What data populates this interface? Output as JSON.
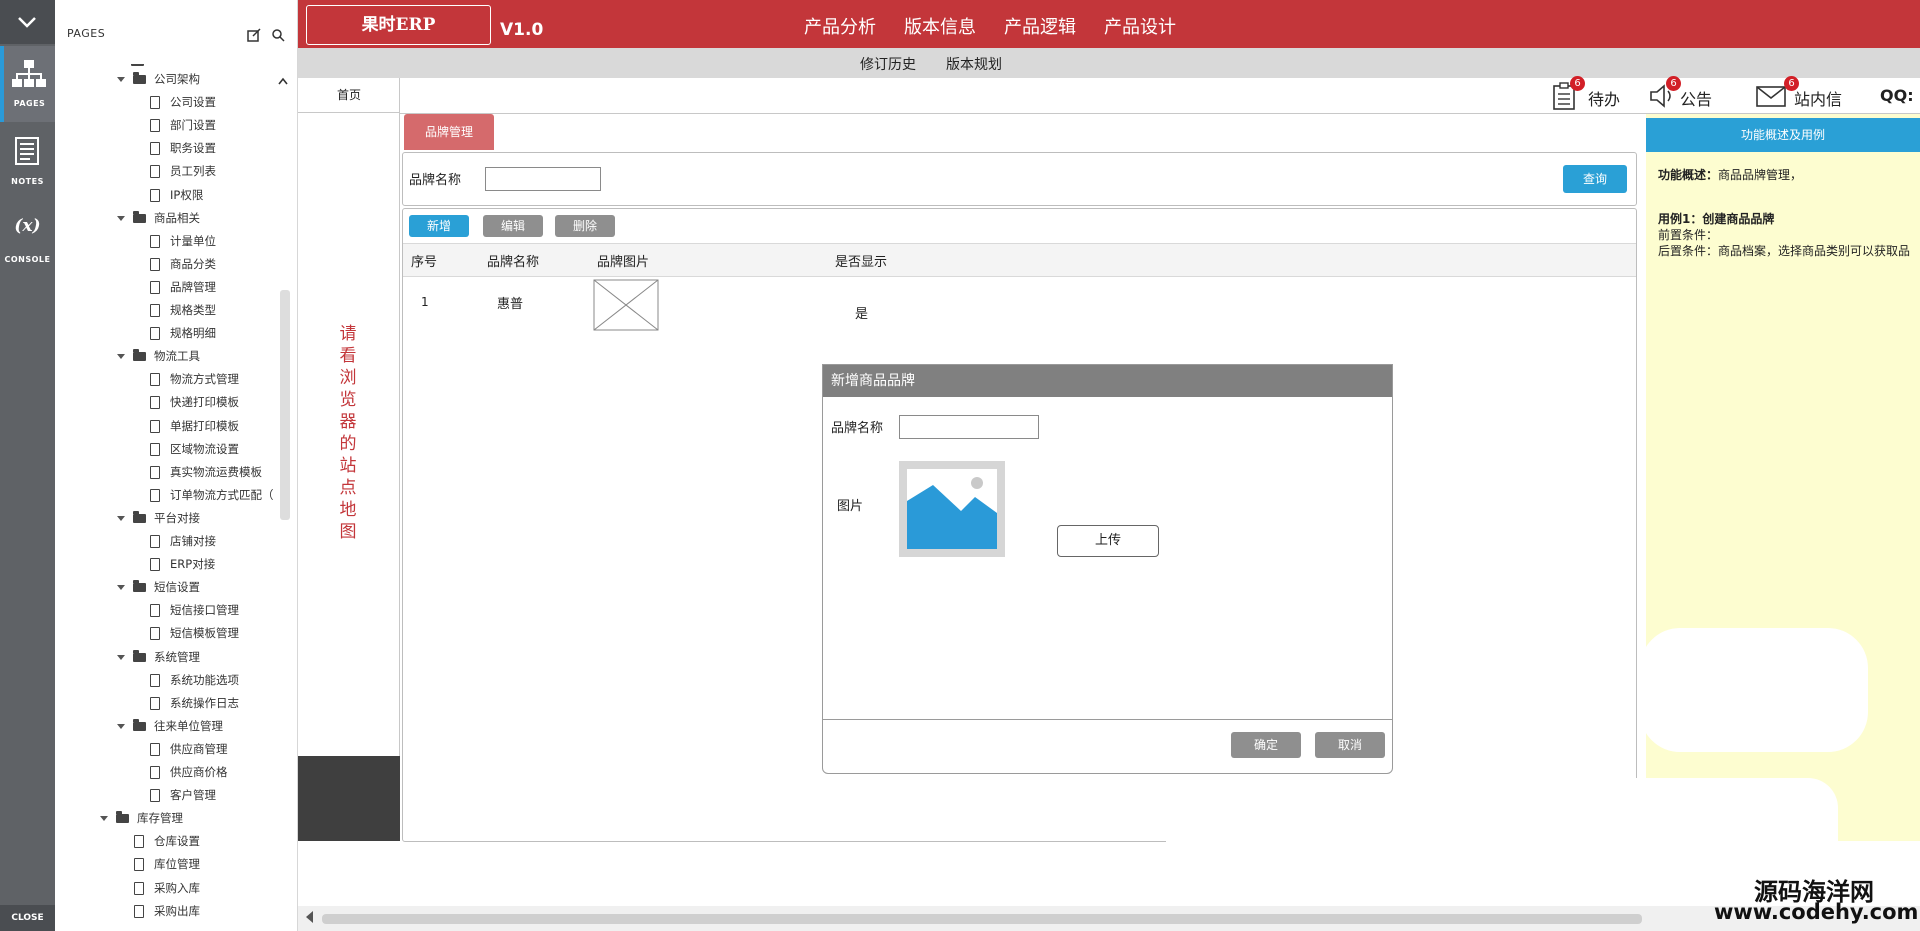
{
  "rail": {
    "pages_label": "PAGES",
    "notes_label": "NOTES",
    "console_label": "CONSOLE",
    "console_glyph": "(x)",
    "close_label": "CLOSE"
  },
  "tree": {
    "title": "PAGES",
    "items": [
      {
        "label": "公司架构",
        "type": "folder"
      },
      {
        "label": "公司设置",
        "type": "page"
      },
      {
        "label": "部门设置",
        "type": "page"
      },
      {
        "label": "职务设置",
        "type": "page"
      },
      {
        "label": "员工列表",
        "type": "page"
      },
      {
        "label": "IP权限",
        "type": "page"
      },
      {
        "label": "商品相关",
        "type": "folder"
      },
      {
        "label": "计量单位",
        "type": "page"
      },
      {
        "label": "商品分类",
        "type": "page"
      },
      {
        "label": "品牌管理",
        "type": "page"
      },
      {
        "label": "规格类型",
        "type": "page"
      },
      {
        "label": "规格明细",
        "type": "page"
      },
      {
        "label": "物流工具",
        "type": "folder"
      },
      {
        "label": "物流方式管理",
        "type": "page"
      },
      {
        "label": "快递打印模板",
        "type": "page"
      },
      {
        "label": "单据打印模板",
        "type": "page"
      },
      {
        "label": "区域物流设置",
        "type": "page"
      },
      {
        "label": "真实物流运费模板",
        "type": "page"
      },
      {
        "label": "订单物流方式匹配（",
        "type": "page"
      },
      {
        "label": "平台对接",
        "type": "folder"
      },
      {
        "label": "店铺对接",
        "type": "page"
      },
      {
        "label": "ERP对接",
        "type": "page"
      },
      {
        "label": "短信设置",
        "type": "folder"
      },
      {
        "label": "短信接口管理",
        "type": "page"
      },
      {
        "label": "短信模板管理",
        "type": "page"
      },
      {
        "label": "系统管理",
        "type": "folder"
      },
      {
        "label": "系统功能选项",
        "type": "page"
      },
      {
        "label": "系统操作日志",
        "type": "page"
      },
      {
        "label": "往来单位管理",
        "type": "folder"
      },
      {
        "label": "供应商管理",
        "type": "page"
      },
      {
        "label": "供应商价格",
        "type": "page"
      },
      {
        "label": "客户管理",
        "type": "page"
      },
      {
        "label": "库存管理",
        "type": "folder"
      },
      {
        "label": "仓库设置",
        "type": "page"
      },
      {
        "label": "库位管理",
        "type": "page"
      },
      {
        "label": "采购入库",
        "type": "page"
      },
      {
        "label": "采购出库",
        "type": "page"
      }
    ]
  },
  "header": {
    "logo": "果时ERP",
    "version": "V1.0",
    "nav": [
      "产品分析",
      "版本信息",
      "产品逻辑",
      "产品设计"
    ],
    "subnav": [
      "修订历史",
      "版本规划"
    ]
  },
  "leftcol": {
    "home_tab": "首页",
    "sitemap_hint": "请看浏览器的站点地图"
  },
  "toolbar": {
    "todo_label": "待办",
    "todo_count": "6",
    "notice_label": "公告",
    "notice_count": "6",
    "mail_label": "站内信",
    "mail_count": "6",
    "qq_label": "QQ:"
  },
  "main": {
    "tab_label": "品牌管理",
    "search_label": "品牌名称",
    "search_value": "",
    "query_button": "查询",
    "actions": [
      "新增",
      "编辑",
      "删除"
    ],
    "columns": [
      "序号",
      "品牌名称",
      "品牌图片",
      "是否显示"
    ],
    "rows": [
      {
        "index": "1",
        "name": "惠普",
        "visible": "是"
      }
    ]
  },
  "modal": {
    "title": "新增商品品牌",
    "name_label": "品牌名称",
    "name_value": "",
    "image_label": "图片",
    "upload_button": "上传",
    "confirm_button": "确定",
    "cancel_button": "取消"
  },
  "rightpanel": {
    "header": "功能概述及用例",
    "overview_label": "功能概述：",
    "overview_text": "商品品牌管理，",
    "usecase_title": "用例1：创建商品品牌",
    "precondition": "前置条件：",
    "postcondition": "后置条件：商品档案，选择商品类别可以获取品"
  },
  "watermark": {
    "cn": "源码海洋网",
    "url": "www.codehy.com"
  },
  "colors": {
    "brand_red": "#c3363a",
    "accent_blue": "#2aa0d6",
    "panel_yellow": "#fdfdd0"
  }
}
